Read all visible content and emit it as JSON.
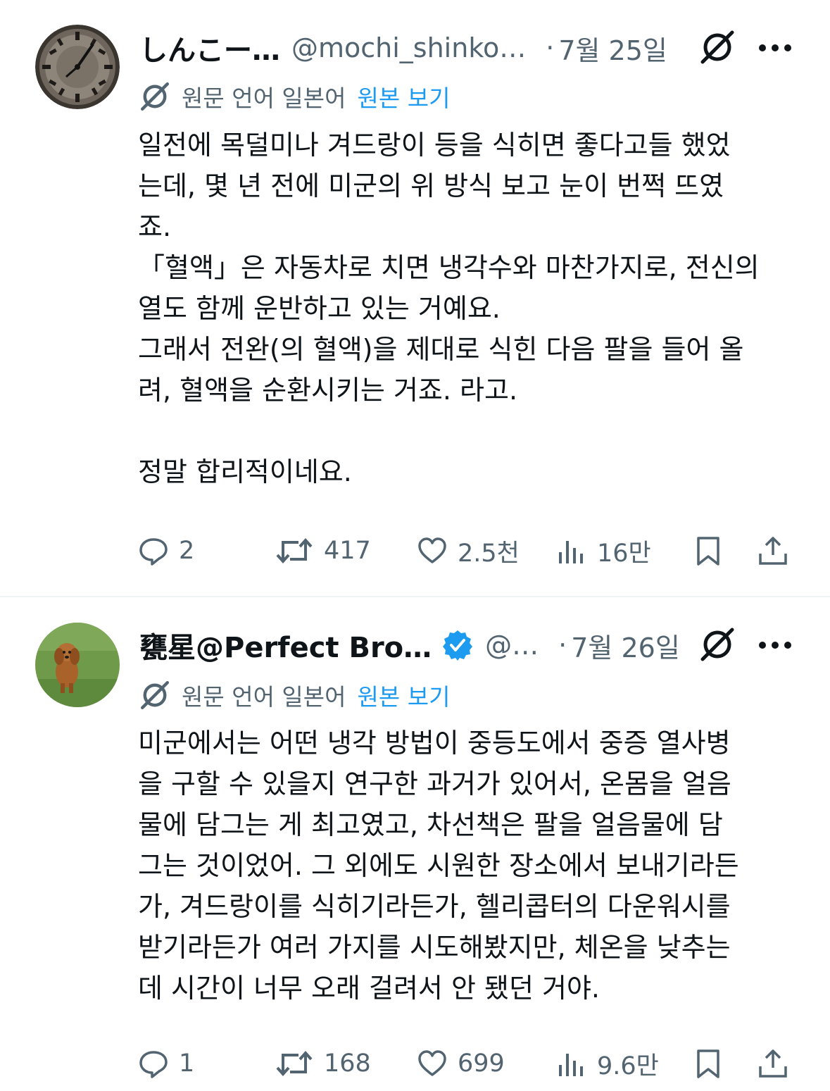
{
  "tweets": [
    {
      "author_name": "しんこー…",
      "handle": "@mochi_shinko…",
      "dot": "·",
      "date": "7월 25일",
      "avatar_icon": "clock-avatar",
      "verified": false,
      "translation": {
        "prefix": "원문 언어 일본어",
        "link": "원본 보기"
      },
      "body": "일전에 목덜미나 겨드랑이 등을 식히면 좋다고들 했었\n는데, 몇 년 전에 미군의 위 방식 보고 눈이 번쩍 뜨였\n죠.\n「혈액」은 자동차로 치면 냉각수와 마찬가지로, 전신의\n열도 함께 운반하고 있는 거예요.\n그래서 전완(의 혈액)을 제대로 식힌 다음 팔을 들어 올\n려, 혈액을 순환시키는 거죠. 라고.\n\n정말 합리적이네요.",
      "replies": "2",
      "reposts": "417",
      "likes": "2.5천",
      "views": "16만"
    },
    {
      "author_name": "甕星@Perfect Bro…",
      "handle": "@…",
      "dot": "·",
      "date": "7월 26일",
      "avatar_icon": "dog-avatar",
      "verified": true,
      "translation": {
        "prefix": "원문 언어 일본어",
        "link": "원본 보기"
      },
      "body": "미군에서는 어떤 냉각 방법이 중등도에서 중증 열사병\n을 구할 수 있을지 연구한 과거가 있어서, 온몸을 얼음\n물에 담그는 게 최고였고, 차선책은 팔을 얼음물에 담\n그는 것이었어. 그 외에도 시원한 장소에서 보내기라든\n가, 겨드랑이를 식히기라든가, 헬리콥터의 다운워시를\n받기라든가 여러 가지를 시도해봤지만, 체온을 낮추는\n데 시간이 너무 오래 걸려서 안 됐던 거야.",
      "replies": "1",
      "reposts": "168",
      "likes": "699",
      "views": "9.6만"
    }
  ],
  "colors": {
    "text": "#0f1419",
    "muted": "#536471",
    "link": "#1d9bf0",
    "verified": "#1d9bf0",
    "divider": "#eff3f4"
  }
}
